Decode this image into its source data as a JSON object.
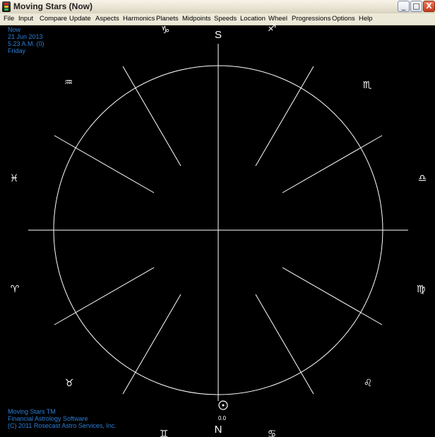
{
  "window": {
    "title": "Moving Stars (Now)",
    "controls": {
      "minimize": "_",
      "maximize": "□",
      "close": "X"
    }
  },
  "menu": [
    "File",
    "Input",
    "Compare",
    "Update",
    "Aspects",
    "Harmonics",
    "Planets",
    "Midpoints",
    "Speeds",
    "Location",
    "Wheel",
    "Progressions",
    "Options",
    "Help"
  ],
  "chart_info": {
    "label": "Now",
    "date": "21 Jun 2013",
    "time": "5.23 A.M. (0)",
    "weekday": "Friday"
  },
  "footer": {
    "product": "Moving Stars TM",
    "tagline": "Financial Astrology Software",
    "copyright": "(C) 2011 Rosecast Astro Services, Inc."
  },
  "wheel": {
    "top_label": "S",
    "bottom_label": "N",
    "sun_position": "0.0",
    "colors": {
      "lines": "#ffffff",
      "background": "#000000",
      "info_text": "#2b7fd8"
    },
    "signs": [
      "♑",
      "♐",
      "♏",
      "♎",
      "♍",
      "♌",
      "♋",
      "♊",
      "♉",
      "♈",
      "♓",
      "♒"
    ]
  }
}
